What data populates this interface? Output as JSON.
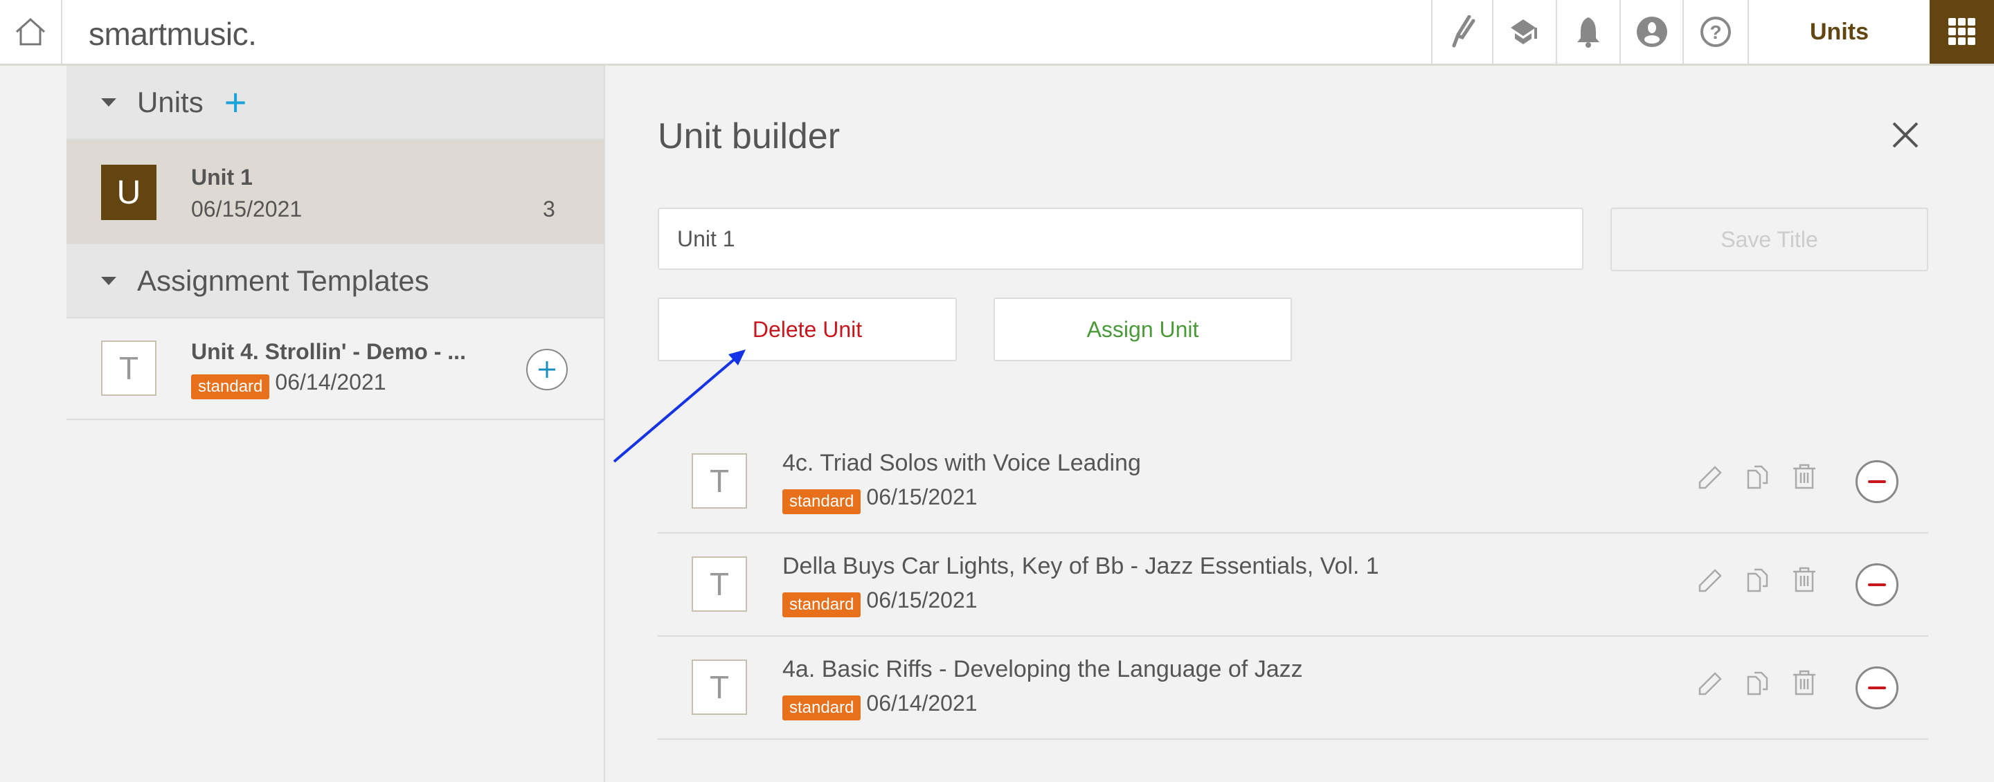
{
  "header": {
    "logo": "smartmusic.",
    "units_label": "Units",
    "icons": [
      "home-icon",
      "tuning-fork-icon",
      "graduation-cap-icon",
      "bell-icon",
      "user-icon",
      "help-icon",
      "apps-grid-icon"
    ],
    "brand_color": "#634511"
  },
  "sidebar": {
    "units_section": {
      "label": "Units",
      "add": "+"
    },
    "units": [
      {
        "initial": "U",
        "name": "Unit 1",
        "date": "06/15/2021",
        "count": "3"
      }
    ],
    "templates_section": {
      "label": "Assignment Templates"
    },
    "templates": [
      {
        "initial": "T",
        "name": "Unit 4. Strollin' - Demo - ...",
        "badge": "standard",
        "date": "06/14/2021"
      }
    ]
  },
  "builder": {
    "title": "Unit builder",
    "title_input": "Unit 1",
    "save_title": "Save Title",
    "delete_unit": "Delete Unit",
    "assign_unit": "Assign Unit",
    "items": [
      {
        "initial": "T",
        "title": "4c. Triad Solos with Voice Leading",
        "badge": "standard",
        "date": "06/15/2021"
      },
      {
        "initial": "T",
        "title": "Della Buys Car Lights, Key of Bb - Jazz Essentials, Vol. 1",
        "badge": "standard",
        "date": "06/15/2021"
      },
      {
        "initial": "T",
        "title": "4a. Basic Riffs - Developing the Language of Jazz",
        "badge": "standard",
        "date": "06/14/2021"
      }
    ]
  },
  "colors": {
    "delete": "#c8161d",
    "assign": "#4a9a3a",
    "badge": "#e8701a",
    "annotation_arrow": "#1533e6"
  }
}
